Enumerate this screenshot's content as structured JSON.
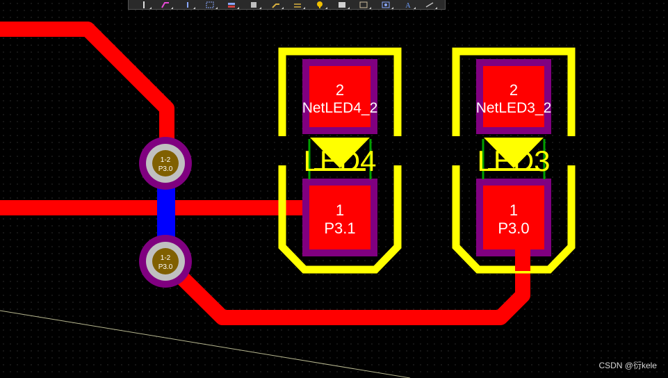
{
  "toolbar": {
    "tools": [
      {
        "name": "pin-tool-icon",
        "color": "#e0e0e0"
      },
      {
        "name": "route-tool-icon",
        "color": "#e64ad6"
      },
      {
        "name": "probe-tool-icon",
        "color": "#8aa8ff"
      },
      {
        "name": "select-rect-icon",
        "color": "#8aa8ff"
      },
      {
        "name": "align-icon",
        "color": "#8aa8ff"
      },
      {
        "name": "component-icon",
        "color": "#c0c0c0"
      },
      {
        "name": "interactive-route-icon",
        "color": "#d8b040"
      },
      {
        "name": "diff-pair-icon",
        "color": "#d8b040"
      },
      {
        "name": "via-icon",
        "color": "#f0c000"
      },
      {
        "name": "fill-icon",
        "color": "#d0d0d0"
      },
      {
        "name": "region-icon",
        "color": "#d0c0a0"
      },
      {
        "name": "dimension-icon",
        "color": "#8aa8ff"
      },
      {
        "name": "text-tool-icon",
        "color": "#6fa0ff"
      },
      {
        "name": "line-tool-icon",
        "color": "#c0c0c0"
      }
    ]
  },
  "components": [
    {
      "designator": "LED4",
      "pads": [
        {
          "number": "2",
          "net": "NetLED4_2"
        },
        {
          "number": "1",
          "net": "P3.1"
        }
      ]
    },
    {
      "designator": "LED3",
      "pads": [
        {
          "number": "2",
          "net": "NetLED3_2"
        },
        {
          "number": "1",
          "net": "P3.0"
        }
      ]
    }
  ],
  "vias": [
    {
      "layers": "1-2",
      "net": "P3.0"
    },
    {
      "layers": "1-2",
      "net": "P3.0"
    }
  ],
  "colors": {
    "background": "#000000",
    "grid": "#5a5a5a",
    "top_copper": "#ff0000",
    "bottom_copper": "#0000ff",
    "silkscreen": "#ffff00",
    "solder_mask": "#800080",
    "via_pad": "#c0c0c0",
    "via_hole": "#806000",
    "pad_text": "#ffffff"
  },
  "watermark": "CSDN @衍kele"
}
